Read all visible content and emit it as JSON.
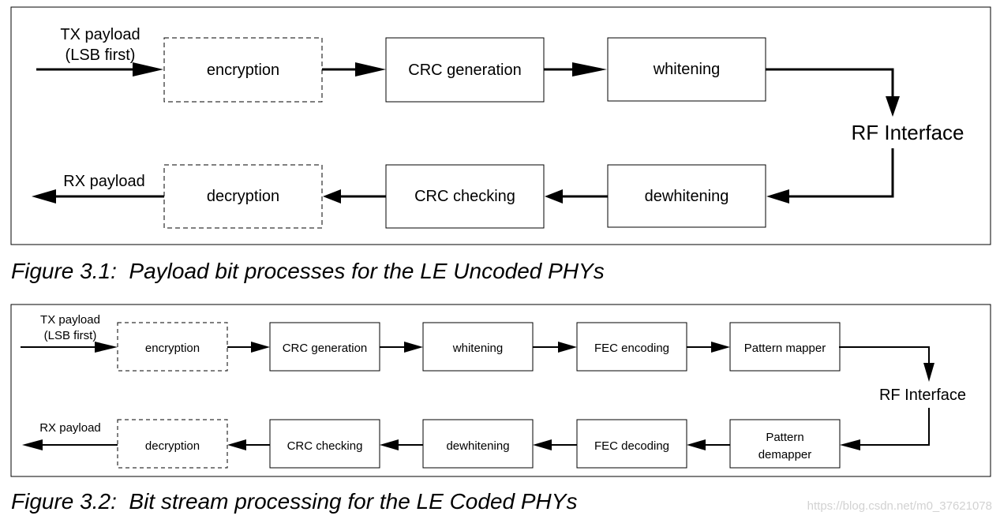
{
  "figure1": {
    "caption": "Figure 3.1:  Payload bit processes for the LE Uncoded PHYs",
    "tx_label_line1": "TX payload",
    "tx_label_line2": "(LSB first)",
    "rx_label": "RX payload",
    "rf_label": "RF Interface",
    "tx_blocks": [
      {
        "label": "encryption",
        "optional": true
      },
      {
        "label": "CRC generation",
        "optional": false
      },
      {
        "label": "whitening",
        "optional": false
      }
    ],
    "rx_blocks": [
      {
        "label": "decryption",
        "optional": true
      },
      {
        "label": "CRC checking",
        "optional": false
      },
      {
        "label": "dewhitening",
        "optional": false
      }
    ]
  },
  "figure2": {
    "caption": "Figure 3.2:  Bit stream processing for the LE Coded PHYs",
    "tx_label_line1": "TX payload",
    "tx_label_line2": "(LSB first)",
    "rx_label": "RX payload",
    "rf_label": "RF Interface",
    "tx_blocks": [
      {
        "label": "encryption",
        "optional": true
      },
      {
        "label": "CRC generation",
        "optional": false
      },
      {
        "label": "whitening",
        "optional": false
      },
      {
        "label": "FEC encoding",
        "optional": false
      },
      {
        "label": "Pattern mapper",
        "optional": false
      }
    ],
    "rx_blocks": [
      {
        "label": "decryption",
        "optional": true
      },
      {
        "label": "CRC checking",
        "optional": false
      },
      {
        "label": "dewhitening",
        "optional": false
      },
      {
        "label": "FEC decoding",
        "optional": false
      },
      {
        "label": "Pattern demapper",
        "optional": false
      }
    ]
  },
  "watermark": "https://blog.csdn.net/m0_37621078"
}
